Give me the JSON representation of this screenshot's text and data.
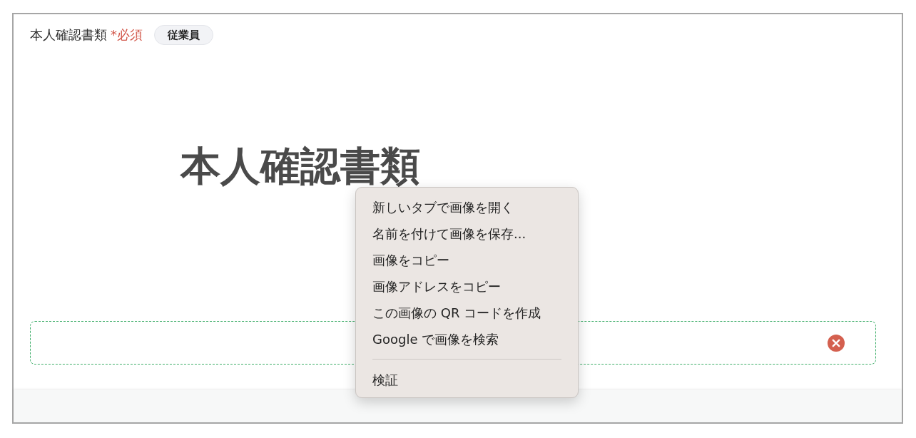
{
  "field": {
    "label": "本人確認書類",
    "required_mark": "*必須",
    "tag": "従業員"
  },
  "preview_image": {
    "text": "本人確認書類"
  },
  "context_menu": {
    "groups": [
      [
        "新しいタブで画像を開く",
        "名前を付けて画像を保存...",
        "画像をコピー",
        "画像アドレスをコピー",
        "この画像の QR コードを作成",
        "Google で画像を検索"
      ],
      [
        "検証"
      ]
    ]
  }
}
